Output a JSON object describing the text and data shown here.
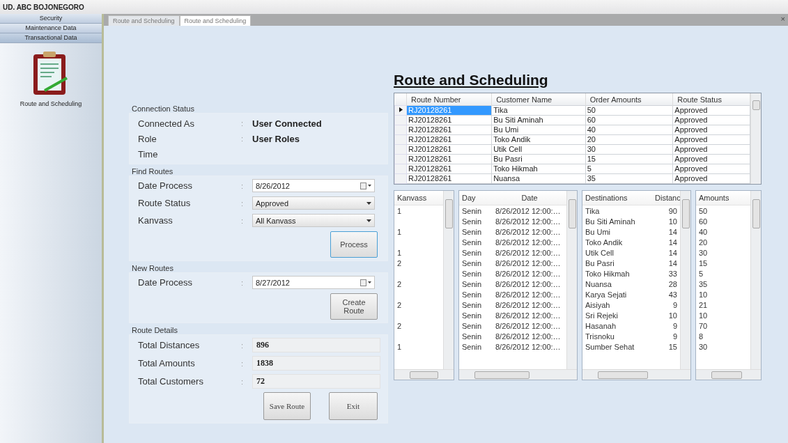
{
  "window": {
    "title": "UD. ABC BOJONEGORO",
    "close": "×"
  },
  "sidebar": {
    "items": [
      {
        "label": "Security",
        "selected": false
      },
      {
        "label": "Maintenance Data",
        "selected": false
      },
      {
        "label": "Transactional Data",
        "selected": true
      }
    ],
    "module": "Route and Scheduling"
  },
  "tabs": [
    {
      "label": "Route and Scheduling",
      "selected": false
    },
    {
      "label": "Route and Scheduling",
      "selected": true
    }
  ],
  "page_title": "Route and Scheduling",
  "separator": ":",
  "connection_status": {
    "title": "Connection Status",
    "rows": [
      {
        "label": "Connected As",
        "value": "User Connected"
      },
      {
        "label": "Role",
        "value": "User Roles"
      },
      {
        "label": "Time"
      }
    ]
  },
  "find_routes": {
    "title": "Find Routes",
    "date_label": "Date Process",
    "date": "8/26/2012",
    "status_label": "Route Status",
    "status": "Approved",
    "kanvass_label": "Kanvass",
    "kanvass": "All Kanvass",
    "button": "Process"
  },
  "new_routes": {
    "title": "New Routes",
    "date_label": "Date Process",
    "date": "8/27/2012",
    "button": "Create Route"
  },
  "route_details": {
    "title": "Route Details",
    "rows": [
      {
        "label": "Total Distances",
        "value": "896"
      },
      {
        "label": "Total Amounts",
        "value": "1838"
      },
      {
        "label": "Total Customers",
        "value": "72"
      }
    ],
    "buttons": [
      "Save Route",
      "Exit"
    ]
  },
  "routes_table": {
    "columns": [
      "Route Number",
      "Customer Name",
      "Order Amounts",
      "Route Status"
    ],
    "rows": [
      {
        "selected": true,
        "cells": [
          "RJ20128261",
          "Tika",
          "50",
          "Approved"
        ]
      },
      {
        "selected": false,
        "cells": [
          "RJ20128261",
          "Bu Siti Aminah",
          "60",
          "Approved"
        ]
      },
      {
        "selected": false,
        "cells": [
          "RJ20128261",
          "Bu Umi",
          "40",
          "Approved"
        ]
      },
      {
        "selected": false,
        "cells": [
          "RJ20128261",
          "Toko Andik",
          "20",
          "Approved"
        ]
      },
      {
        "selected": false,
        "cells": [
          "RJ20128261",
          "Utik Cell",
          "30",
          "Approved"
        ]
      },
      {
        "selected": false,
        "cells": [
          "RJ20128261",
          "Bu Pasri",
          "15",
          "Approved"
        ]
      },
      {
        "selected": false,
        "cells": [
          "RJ20128261",
          "Toko Hikmah",
          "5",
          "Approved"
        ]
      },
      {
        "selected": false,
        "cells": [
          "RJ20128261",
          "Nuansa",
          "35",
          "Approved"
        ]
      }
    ]
  },
  "schedule": {
    "columns": {
      "kanvass": "Kanvass",
      "day": "Day",
      "date": "Date",
      "destination": "Destinations",
      "distance": "Distanc",
      "amount": "Amounts"
    },
    "rows": [
      {
        "kanvass": "1",
        "day": "Senin",
        "date": "8/26/2012 12:00:…",
        "destination": "Tika",
        "distance": "90",
        "amount": "50"
      },
      {
        "day": "Senin",
        "date": "8/26/2012 12:00:…",
        "destination": "Bu Siti Aminah",
        "distance": "10",
        "amount": "60"
      },
      {
        "kanvass": "1",
        "day": "Senin",
        "date": "8/26/2012 12:00:…",
        "destination": "Bu Umi",
        "distance": "14",
        "amount": "40"
      },
      {
        "day": "Senin",
        "date": "8/26/2012 12:00:…",
        "destination": "Toko Andik",
        "distance": "14",
        "amount": "20"
      },
      {
        "kanvass": "1",
        "day": "Senin",
        "date": "8/26/2012 12:00:…",
        "destination": "Utik Cell",
        "distance": "14",
        "amount": "30"
      },
      {
        "kanvass": "2",
        "day": "Senin",
        "date": "8/26/2012 12:00:…",
        "destination": "Bu Pasri",
        "distance": "14",
        "amount": "15"
      },
      {
        "day": "Senin",
        "date": "8/26/2012 12:00:…",
        "destination": "Toko Hikmah",
        "distance": "33",
        "amount": "5"
      },
      {
        "kanvass": "2",
        "day": "Senin",
        "date": "8/26/2012 12:00:…",
        "destination": "Nuansa",
        "distance": "28",
        "amount": "35"
      },
      {
        "day": "Senin",
        "date": "8/26/2012 12:00:…",
        "destination": "Karya Sejati",
        "distance": "43",
        "amount": "10"
      },
      {
        "kanvass": "2",
        "day": "Senin",
        "date": "8/26/2012 12:00:…",
        "destination": "Aisiyah",
        "distance": "9",
        "amount": "21"
      },
      {
        "day": "Senin",
        "date": "8/26/2012 12:00:…",
        "destination": "Sri Rejeki",
        "distance": "10",
        "amount": "10"
      },
      {
        "kanvass": "2",
        "day": "Senin",
        "date": "8/26/2012 12:00:…",
        "destination": "Hasanah",
        "distance": "9",
        "amount": "70"
      },
      {
        "day": "Senin",
        "date": "8/26/2012 12:00:…",
        "destination": "Trisnoku",
        "distance": "9",
        "amount": "8"
      },
      {
        "kanvass": "1",
        "day": "Senin",
        "date": "8/26/2012 12:00:…",
        "destination": "Sumber Sehat",
        "distance": "15",
        "amount": "30"
      }
    ]
  }
}
